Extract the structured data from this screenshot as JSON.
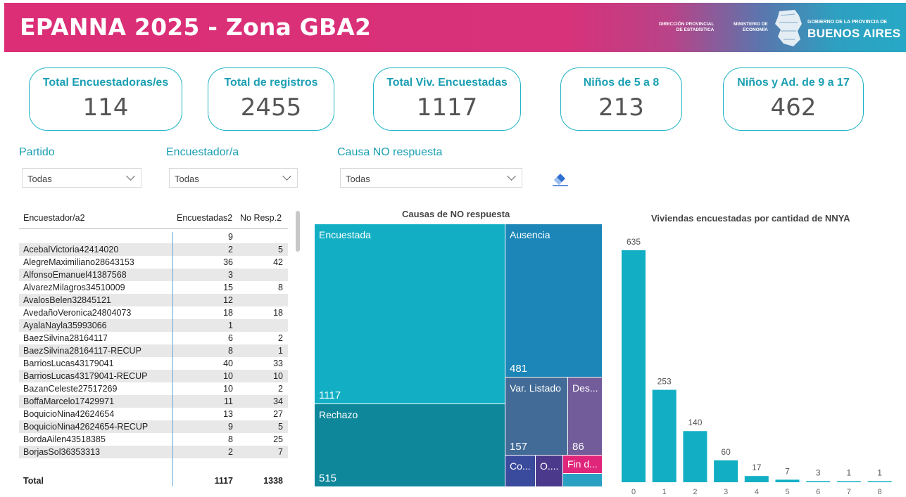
{
  "header": {
    "title": "EPANNA 2025 - Zona GBA2",
    "logo_dpe": [
      "DIRECCIÓN PROVINCIAL",
      "DE ESTADÍSTICA"
    ],
    "logo_ministerio": [
      "MINISTERIO DE",
      "ECONOMÍA"
    ],
    "logo_gob_small": "GOBIERNO DE LA PROVINCIA DE",
    "logo_gob_big": "BUENOS AIRES"
  },
  "kpis": [
    {
      "label": "Total Encuestadoras/es",
      "value": "114"
    },
    {
      "label": "Total de registros",
      "value": "2455"
    },
    {
      "label": "Total Viv. Encuestadas",
      "value": "1117"
    },
    {
      "label": "Niños de 5 a 8",
      "value": "213"
    },
    {
      "label": "Niños y Ad. de 9 a 17",
      "value": "462"
    }
  ],
  "filters": [
    {
      "label": "Partido",
      "value": "Todas"
    },
    {
      "label": "Encuestador/a",
      "value": "Todas"
    },
    {
      "label": "Causa NO respuesta",
      "value": "Todas"
    }
  ],
  "table": {
    "headers": [
      "Encuestador/a2",
      "Encuestadas2",
      "No Resp.2"
    ],
    "rows": [
      [
        "",
        "9",
        ""
      ],
      [
        "AcebalVictoria42414020",
        "2",
        "5"
      ],
      [
        "AlegreMaximiliano28643153",
        "36",
        "42"
      ],
      [
        "AlfonsoEmanuel41387568",
        "3",
        ""
      ],
      [
        "AlvarezMilagros34510009",
        "15",
        "8"
      ],
      [
        "AvalosBelen32845121",
        "12",
        ""
      ],
      [
        "AvedañoVeronica24804073",
        "18",
        "18"
      ],
      [
        "AyalaNayla35993066",
        "1",
        ""
      ],
      [
        "BaezSilvina28164117",
        "6",
        "2"
      ],
      [
        "BaezSilvina28164117-RECUP",
        "8",
        "1"
      ],
      [
        "BarriosLucas43179041",
        "40",
        "33"
      ],
      [
        "BarriosLucas43179041-RECUP",
        "10",
        "10"
      ],
      [
        "BazanCeleste27517269",
        "10",
        "2"
      ],
      [
        "BoffaMarcelo17429971",
        "11",
        "34"
      ],
      [
        "BoquicioNina42624654",
        "13",
        "27"
      ],
      [
        "BoquicioNina42624654-RECUP",
        "9",
        "5"
      ],
      [
        "BordaAilen43518385",
        "8",
        "25"
      ],
      [
        "BorjasSol36353313",
        "2",
        "7"
      ]
    ],
    "total": [
      "Total",
      "1117",
      "1338"
    ]
  },
  "treemap": {
    "title": "Causas de NO respuesta",
    "cells": [
      {
        "label": "Encuestada",
        "value": "1117",
        "color": "#12afc4"
      },
      {
        "label": "Rechazo",
        "value": "515",
        "color": "#0e879b"
      },
      {
        "label": "Ausencia",
        "value": "481",
        "color": "#1b86b7"
      },
      {
        "label": "Var. Listado",
        "value": "157",
        "color": "#426b97"
      },
      {
        "label": "Des...",
        "value": "86",
        "color": "#725c9a"
      },
      {
        "label": "Co...",
        "value": "",
        "color": "#3a4a9c"
      },
      {
        "label": "O....",
        "value": "",
        "color": "#4b3a8c"
      },
      {
        "label": "Fin d...",
        "value": "",
        "color": "#e0267a"
      },
      {
        "label": "",
        "value": "",
        "color": "#2aa1c2"
      }
    ]
  },
  "chart_data": {
    "type": "bar",
    "title": "Viviendas encuestadas por cantidad de NNYA",
    "categories": [
      "0",
      "1",
      "2",
      "3",
      "4",
      "5",
      "6",
      "7",
      "8"
    ],
    "values": [
      635,
      253,
      140,
      60,
      17,
      7,
      3,
      1,
      1
    ],
    "ylim": [
      0,
      635
    ],
    "color": "#12afc4",
    "grid": false
  }
}
